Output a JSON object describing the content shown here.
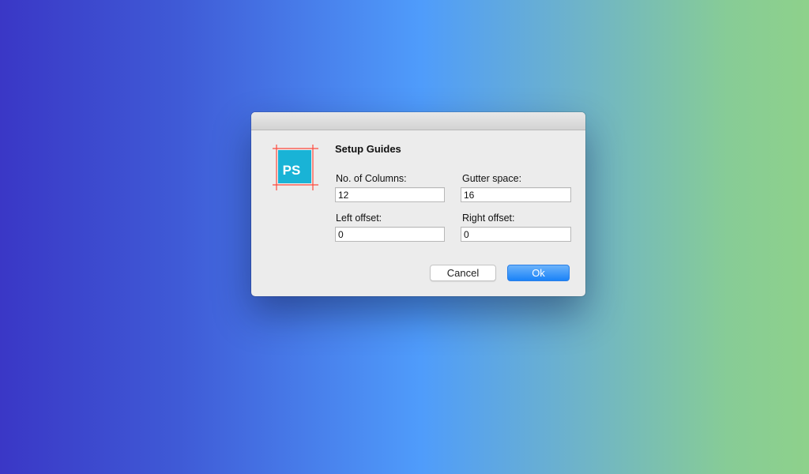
{
  "dialog": {
    "title": "Setup Guides",
    "icon": {
      "name": "photoshop-guides-icon",
      "text": "PS",
      "fill_color": "#19b3d6",
      "guide_color": "#ff4a3d"
    },
    "fields": {
      "columns": {
        "label": "No. of Columns:",
        "value": "12"
      },
      "gutter": {
        "label": "Gutter space:",
        "value": "16"
      },
      "left_offset": {
        "label": "Left offset:",
        "value": "0"
      },
      "right_offset": {
        "label": "Right offset:",
        "value": "0"
      }
    },
    "buttons": {
      "cancel": "Cancel",
      "ok": "Ok"
    }
  },
  "colors": {
    "accent": "#1a82f8",
    "dialog_bg": "#ececec"
  }
}
